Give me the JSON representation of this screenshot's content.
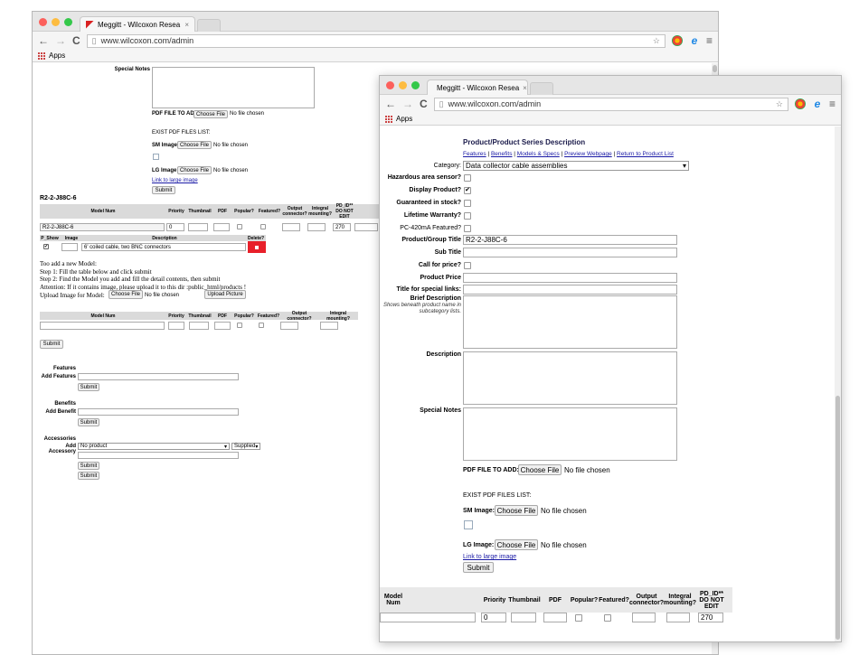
{
  "browser": {
    "tab_title": "Meggitt - Wilcoxon Resea",
    "tab_close": "×",
    "url": "www.wilcoxon.com/admin",
    "bookmarks_label": "Apps",
    "back": "←",
    "forward": "→",
    "reload": "C",
    "star": "☆",
    "menu": "≡"
  },
  "back_window": {
    "special_notes_label": "Special Notes",
    "pdf_file_label": "PDF FILE TO ADD:",
    "choose_file": "Choose File",
    "no_file": "No file chosen",
    "exist_pdf_label": "EXIST PDF FILES LIST:",
    "sm_image_label": "SM Image:",
    "lg_image_label": "LG Image:",
    "link_large_image": "Link to large image",
    "submit": "Submit",
    "model_heading": "R2-2-J88C-6",
    "model_table_headers": [
      "Model Num",
      "Priority",
      "Thumbnail",
      "PDF",
      "Popular?",
      "Featured?",
      "Output connector?",
      "Integral mounting?",
      "PD_ID** DO NOT EDIT"
    ],
    "model_row": {
      "model_num": "R2-2-J88C-6",
      "priority": "0",
      "pd_id": "270"
    },
    "desc_headers": [
      "P_Show",
      "Image",
      "Description",
      "Delete?"
    ],
    "desc_row": {
      "description": "6' coiled cable, two BNC connectors"
    },
    "instructions": [
      "Too add a new Model:",
      "Step 1: Fill the table below and click submit",
      "Step 2: Find the Model you add and fill the detail contents, then submit",
      "Attention: If it contains image, please upload it to this dir :public_html/products !"
    ],
    "upload_label": "Upload Image for Model:",
    "upload_button": "Upload Picture",
    "new_model_headers": [
      "Model Num",
      "Priority",
      "Thumbnail",
      "PDF",
      "Popular?",
      "Featured?",
      "Output connector?",
      "Integral mounting?"
    ],
    "features_heading": "Features",
    "add_features_label": "Add Features",
    "benefits_heading": "Benefits",
    "add_benefit_label": "Add Benefit",
    "accessories_heading": "Accessories",
    "add_accessory_label": "Add Accessory",
    "accessory_select": "No product",
    "supplied_select": "Supplied"
  },
  "front_window": {
    "section_title": "Product/Product Series Description",
    "nav_links": [
      "Features",
      "Benefits",
      "Models & Specs",
      "Preview Webpage",
      "Return to Product List"
    ],
    "nav_sep": " | ",
    "category_label": "Category:",
    "category_value": "Data collector cable assemblies",
    "hazardous_label": "Hazardous area sensor?",
    "display_label": "Display Product?",
    "guaranteed_label": "Guaranteed in stock?",
    "lifetime_label": "Lifetime Warranty?",
    "pc420_label": "PC-420mA Featured?",
    "group_title_label": "Product/Group Title",
    "group_title_value": "R2-2-J88C-6",
    "sub_title_label": "Sub Title",
    "call_price_label": "Call for price?",
    "product_price_label": "Product Price",
    "special_links_label": "Title for special links:",
    "brief_desc_label": "Brief Description",
    "brief_desc_hint": "Shows beneath product name in subcategory lists.",
    "description_label": "Description",
    "special_notes_label": "Special Notes",
    "pdf_file_label": "PDF FILE TO ADD:",
    "choose_file": "Choose File",
    "no_file": "No file chosen",
    "exist_pdf_label": "EXIST PDF FILES LIST:",
    "sm_image_label": "SM Image:",
    "lg_image_label": "LG Image:",
    "link_large_image": "Link to large image",
    "submit": "Submit",
    "table_headers": [
      "Model Num",
      "Priority",
      "Thumbnail",
      "PDF",
      "Popular?",
      "Featured?",
      "Output connector?",
      "Integral mounting?",
      "PD_ID** DO NOT EDIT"
    ],
    "table_row": {
      "priority": "0",
      "pd_id": "270"
    }
  }
}
